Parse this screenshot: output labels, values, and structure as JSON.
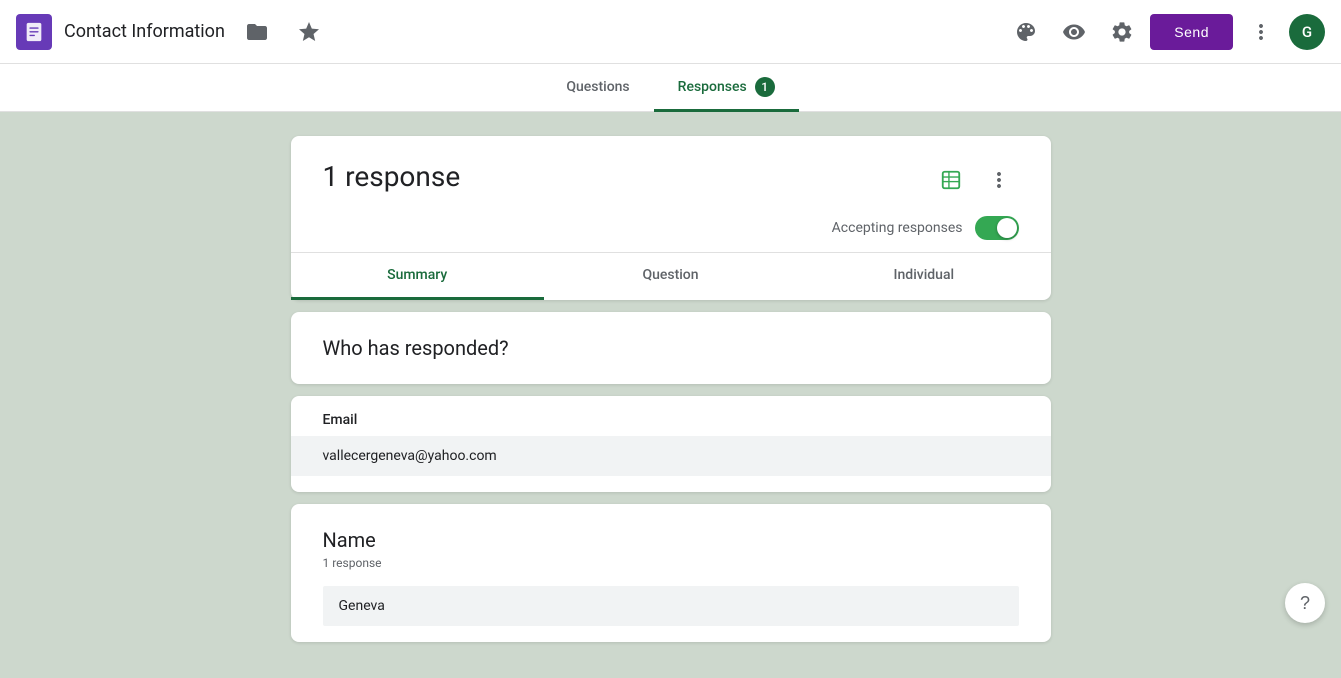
{
  "app": {
    "icon_label": "Google Forms",
    "title": "Contact Information"
  },
  "topbar": {
    "folder_icon": "folder",
    "star_icon": "star",
    "palette_icon": "palette",
    "preview_icon": "eye",
    "settings_icon": "settings",
    "more_icon": "more-vertical",
    "send_label": "Send",
    "user_initial": "G"
  },
  "tabs": [
    {
      "id": "questions",
      "label": "Questions",
      "active": false,
      "badge": null
    },
    {
      "id": "responses",
      "label": "Responses",
      "active": true,
      "badge": "1"
    }
  ],
  "response_section": {
    "count_label": "1 response",
    "accepting_label": "Accepting responses",
    "sheets_icon": "sheets",
    "more_icon": "more"
  },
  "sub_tabs": [
    {
      "id": "summary",
      "label": "Summary",
      "active": true
    },
    {
      "id": "question",
      "label": "Question",
      "active": false
    },
    {
      "id": "individual",
      "label": "Individual",
      "active": false
    }
  ],
  "who_section": {
    "title": "Who has responded?"
  },
  "email_section": {
    "label": "Email",
    "value": "vallecergeneva@yahoo.com"
  },
  "name_section": {
    "title": "Name",
    "response_count": "1 response",
    "value": "Geneva"
  },
  "help": {
    "label": "?"
  }
}
